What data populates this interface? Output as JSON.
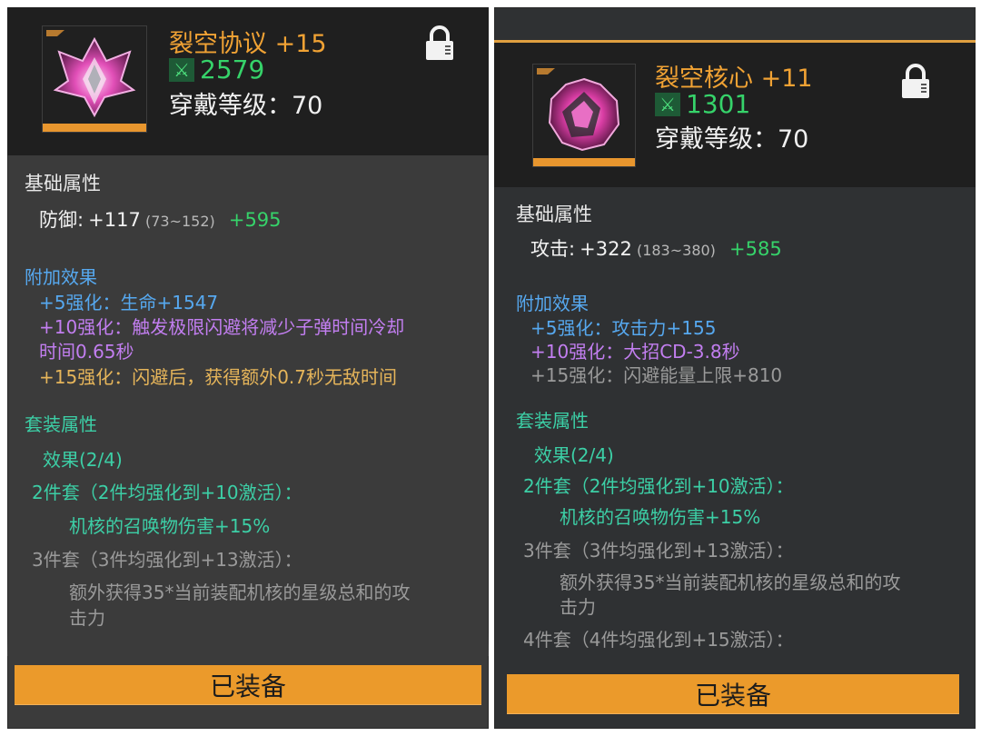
{
  "left": {
    "name": "裂空协议",
    "plus": "+15",
    "power": "2579",
    "wear_level": "穿戴等级：70",
    "base_title": "基础属性",
    "stat_label": "防御:",
    "stat_value": "+117",
    "stat_range": "(73~152)",
    "stat_bonus": "+595",
    "extra_title": "附加效果",
    "extra_5": "+5强化：生命+1547",
    "extra_10_line1": "+10强化：触发极限闪避将减少子弹时间冷却",
    "extra_10_line2": "时间0.65秒",
    "extra_15": "+15强化：闪避后，获得额外0.7秒无敌时间",
    "set_title": "套装属性",
    "set_effect": "效果(2/4)",
    "set2_title": "2件套（2件均强化到+10激活）：",
    "set2_desc": "机核的召唤物伤害+15%",
    "set3_title": "3件套（3件均强化到+13激活）：",
    "set3_desc_line1": "额外获得35*当前装配机核的星级总和的攻",
    "set3_desc_line2": "击力",
    "button": "已装备"
  },
  "right": {
    "name": "裂空核心",
    "plus": "+11",
    "power": "1301",
    "wear_level": "穿戴等级：70",
    "base_title": "基础属性",
    "stat_label": "攻击:",
    "stat_value": "+322",
    "stat_range": "(183~380)",
    "stat_bonus": "+585",
    "extra_title": "附加效果",
    "extra_5": "+5强化：攻击力+155",
    "extra_10": "+10强化：大招CD-3.8秒",
    "extra_15": "+15强化：闪避能量上限+810",
    "set_title": "套装属性",
    "set_effect": "效果(2/4)",
    "set2_title": "2件套（2件均强化到+10激活）：",
    "set2_desc": "机核的召唤物伤害+15%",
    "set3_title": "3件套（3件均强化到+13激活）：",
    "set3_desc_line1": "额外获得35*当前装配机核的星级总和的攻",
    "set3_desc_line2": "击力",
    "set4_title": "4件套（4件均强化到+15激活）：",
    "button": "已装备"
  },
  "icons": {
    "lock": "lock-icon",
    "power": "crossed-swords-icon",
    "item_left": "crystal-crown-icon",
    "item_right": "crystal-core-icon"
  },
  "colors": {
    "title": "#f0a234",
    "power": "#36d36a",
    "button": "#eb9a2b",
    "extra_5": "#56a8ef",
    "extra_10": "#c27ef0",
    "extra_15": "#e6b55a",
    "set_active": "#3ccfa6",
    "set_inactive": "#9a9a9a"
  }
}
